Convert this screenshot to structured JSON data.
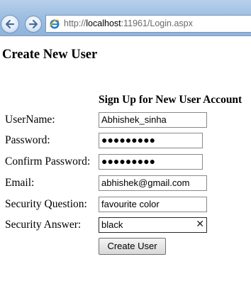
{
  "browser": {
    "address": {
      "prefix": "http://",
      "host": "localhost",
      "rest": ":11961/Login.aspx"
    },
    "icons": {
      "back": "back-arrow-icon",
      "forward": "forward-arrow-icon",
      "page": "ie-logo-icon"
    }
  },
  "page": {
    "title": "Create New User",
    "form_title": "Sign Up for New User Account",
    "fields": {
      "username": {
        "label": "UserName:",
        "value": "Abhishek_sinha"
      },
      "password": {
        "label": "Password:",
        "value": "●●●●●●●●●"
      },
      "confirm": {
        "label": "Confirm Password:",
        "value": "●●●●●●●●●"
      },
      "email": {
        "label": "Email:",
        "value": "abhishek@gmail.com"
      },
      "question": {
        "label": "Security Question:",
        "value": "favourite color"
      },
      "answer": {
        "label": "Security Answer:",
        "value": "black",
        "clear_glyph": "✕"
      }
    },
    "submit_label": "Create User"
  }
}
